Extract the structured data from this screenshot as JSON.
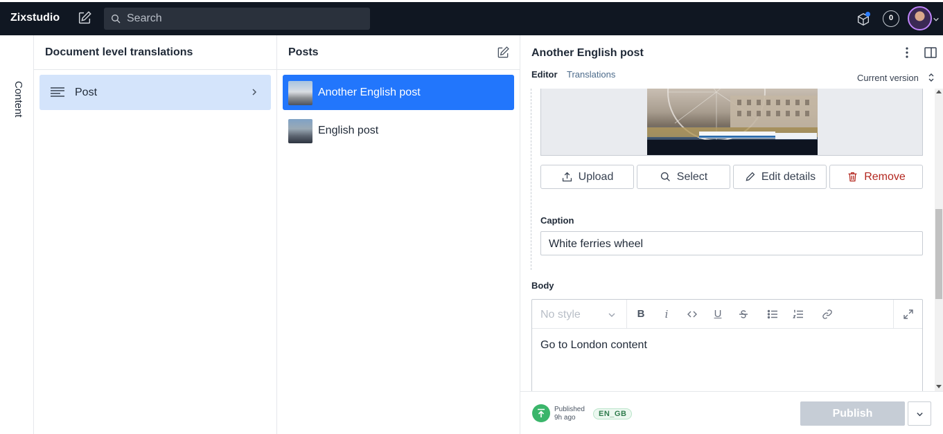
{
  "topbar": {
    "brand": "Zixstudio",
    "search_placeholder": "Search",
    "notification_count": "0"
  },
  "tool_tab": {
    "label": "Content"
  },
  "pane_types": {
    "title": "Document level translations",
    "items": [
      {
        "label": "Post"
      }
    ]
  },
  "pane_documents": {
    "title": "Posts",
    "items": [
      {
        "label": "Another English post",
        "selected": true
      },
      {
        "label": "English post",
        "selected": false
      }
    ]
  },
  "editor": {
    "title": "Another English post",
    "tabs": [
      "Editor",
      "Translations"
    ],
    "version_label": "Current version",
    "image_buttons": {
      "upload": "Upload",
      "select": "Select",
      "edit_details": "Edit details",
      "remove": "Remove"
    },
    "caption": {
      "label": "Caption",
      "value": "White ferries wheel"
    },
    "body": {
      "label": "Body",
      "style_placeholder": "No style",
      "content": "Go to London content"
    }
  },
  "footer": {
    "status_line1": "Published",
    "status_line2": "9h ago",
    "language_badge": "EN_GB",
    "publish_label": "Publish"
  },
  "colors": {
    "topbar_bg": "#101722",
    "selected_item_bg": "#2276fc",
    "type_item_bg": "#d4e4fb",
    "published_green": "#3ab56a",
    "remove_red": "#b3261e"
  }
}
